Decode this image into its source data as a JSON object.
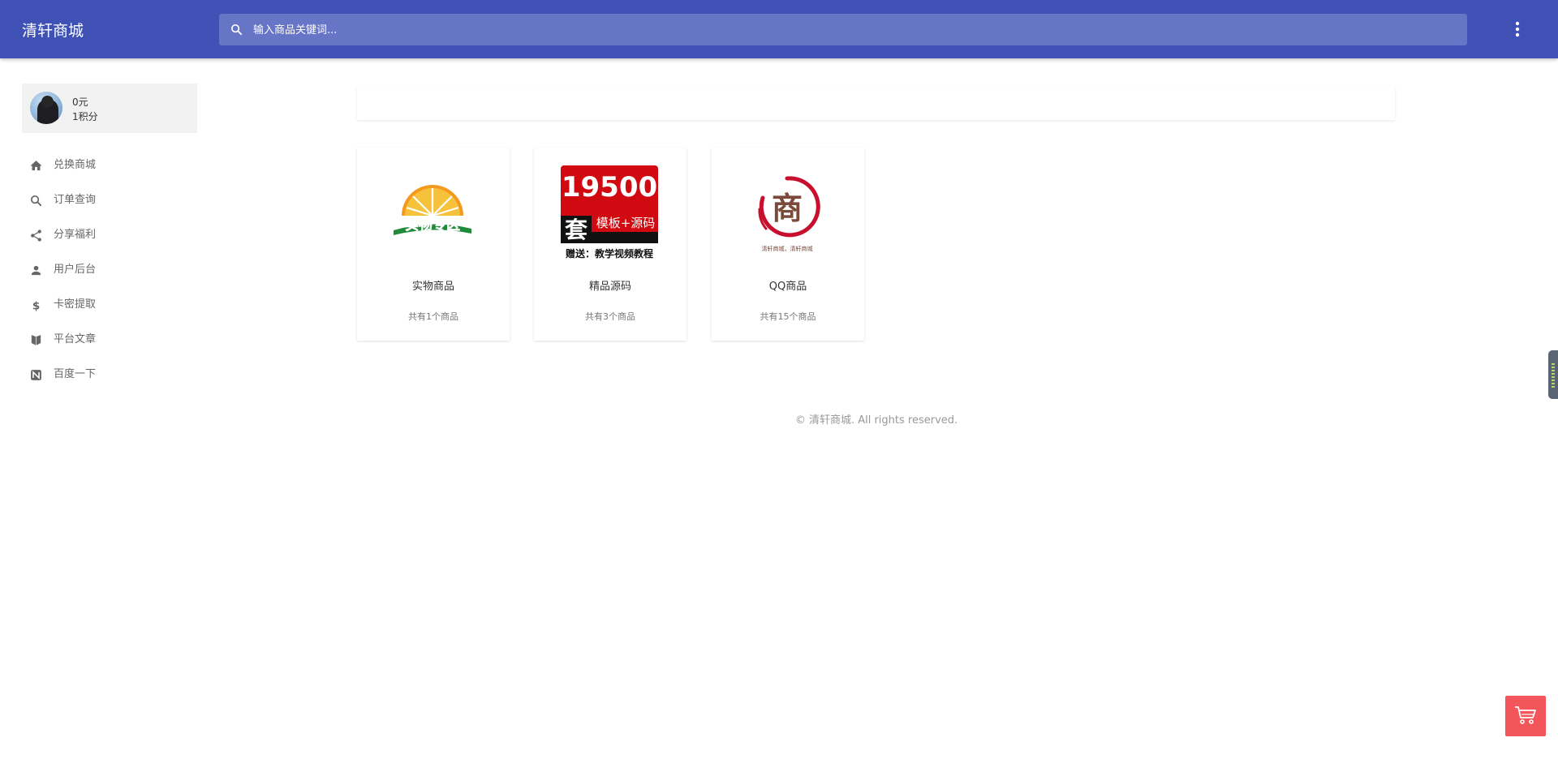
{
  "header": {
    "brand": "清轩商城",
    "search_placeholder": "输入商品关键词..."
  },
  "user": {
    "balance": "0元",
    "points": "1积分"
  },
  "sidebar": {
    "items": [
      {
        "label": "兑换商城",
        "icon": "home-icon"
      },
      {
        "label": "订单查询",
        "icon": "search-icon"
      },
      {
        "label": "分享福利",
        "icon": "share-icon"
      },
      {
        "label": "用户后台",
        "icon": "person-icon"
      },
      {
        "label": "卡密提取",
        "icon": "dollar-icon"
      },
      {
        "label": "平台文章",
        "icon": "book-icon"
      },
      {
        "label": "百度一下",
        "icon": "baidu-icon"
      }
    ]
  },
  "categories": [
    {
      "title": "实物商品",
      "count": "共有1个商品",
      "image_text": "实物专区"
    },
    {
      "title": "精品源码",
      "count": "共有3个商品",
      "image_text": [
        "19500",
        "套",
        "模板+源码",
        "赠送：教学视频教程"
      ]
    },
    {
      "title": "QQ商品",
      "count": "共有15个商品",
      "image_text": [
        "商",
        "清轩商城，清轩商城"
      ]
    }
  ],
  "footer": {
    "text": "© 清轩商城. All rights reserved."
  },
  "colors": {
    "primary": "#3f51b5",
    "search_bg": "#6775c7",
    "cart": "#f2565a",
    "sidebar_text": "#666666",
    "usercard_bg": "#f2f2f2"
  }
}
